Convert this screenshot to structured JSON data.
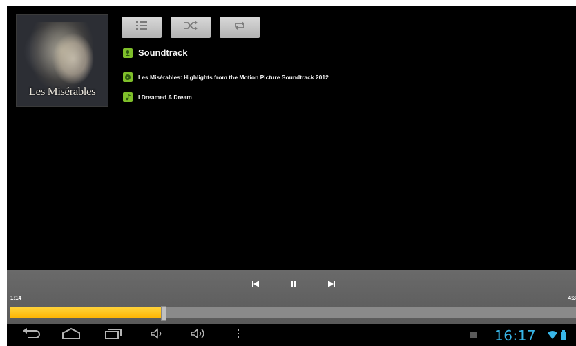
{
  "album": {
    "caption": "Les Misérables"
  },
  "toolbar": {
    "buttons": [
      {
        "icon": "playlist-icon"
      },
      {
        "icon": "shuffle-icon"
      },
      {
        "icon": "repeat-icon"
      }
    ]
  },
  "track": {
    "genre": "Soundtrack",
    "album": "Les Misérables: Highlights from the Motion Picture Soundtrack 2012",
    "title": "I Dreamed A Dream"
  },
  "playback": {
    "elapsed": "1:14",
    "duration": "4:3",
    "progress_fraction": 0.27,
    "accent": "#ffb400"
  },
  "status": {
    "clock": "16:17",
    "clock_color": "#38b6e8"
  },
  "nav": {
    "icons": [
      "back-icon",
      "home-icon",
      "recent-apps-icon",
      "volume-down-icon",
      "volume-up-icon",
      "menu-icon"
    ]
  }
}
